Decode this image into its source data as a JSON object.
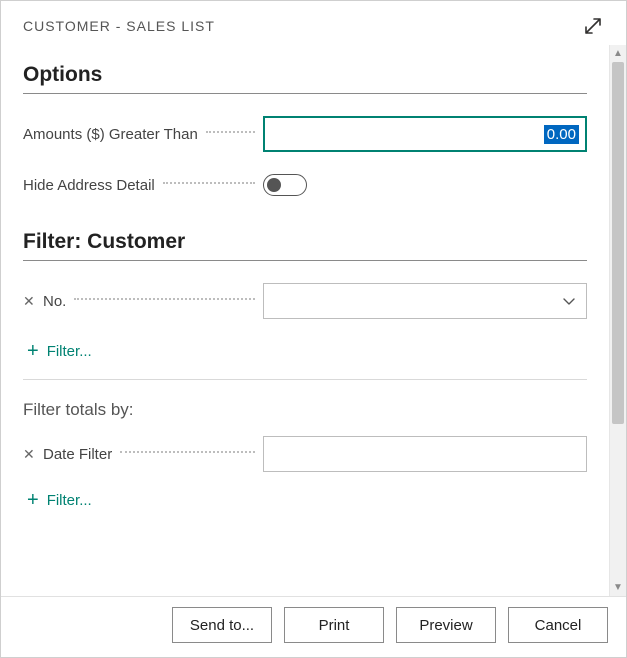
{
  "header": {
    "title": "CUSTOMER - SALES LIST"
  },
  "options": {
    "heading": "Options",
    "amounts_label": "Amounts ($) Greater Than",
    "amounts_value": "0.00",
    "hide_address_label": "Hide Address Detail",
    "hide_address_value": false
  },
  "filter_customer": {
    "heading": "Filter: Customer",
    "no_label": "No.",
    "no_value": "",
    "add_filter_label": "Filter..."
  },
  "filter_totals": {
    "heading": "Filter totals by:",
    "date_filter_label": "Date Filter",
    "date_filter_value": "",
    "add_filter_label": "Filter..."
  },
  "footer": {
    "send_to": "Send to...",
    "print": "Print",
    "preview": "Preview",
    "cancel": "Cancel"
  }
}
